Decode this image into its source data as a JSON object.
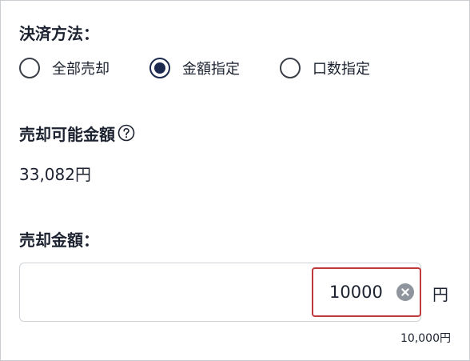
{
  "payment": {
    "label": "決済方法：",
    "options": [
      {
        "label": "全部売却",
        "checked": false
      },
      {
        "label": "金額指定",
        "checked": true
      },
      {
        "label": "口数指定",
        "checked": false
      }
    ]
  },
  "available": {
    "label": "売却可能金額",
    "value": "33,082円",
    "help_icon": "question-circle-icon"
  },
  "amount": {
    "label": "売却金額：",
    "value": "10000",
    "unit": "円",
    "formatted": "10,000円",
    "clear_icon": "clear-circle-icon"
  },
  "colors": {
    "radio_selected": "#1b2a4e",
    "highlight_border": "#c0393b",
    "text": "#1c2230"
  }
}
